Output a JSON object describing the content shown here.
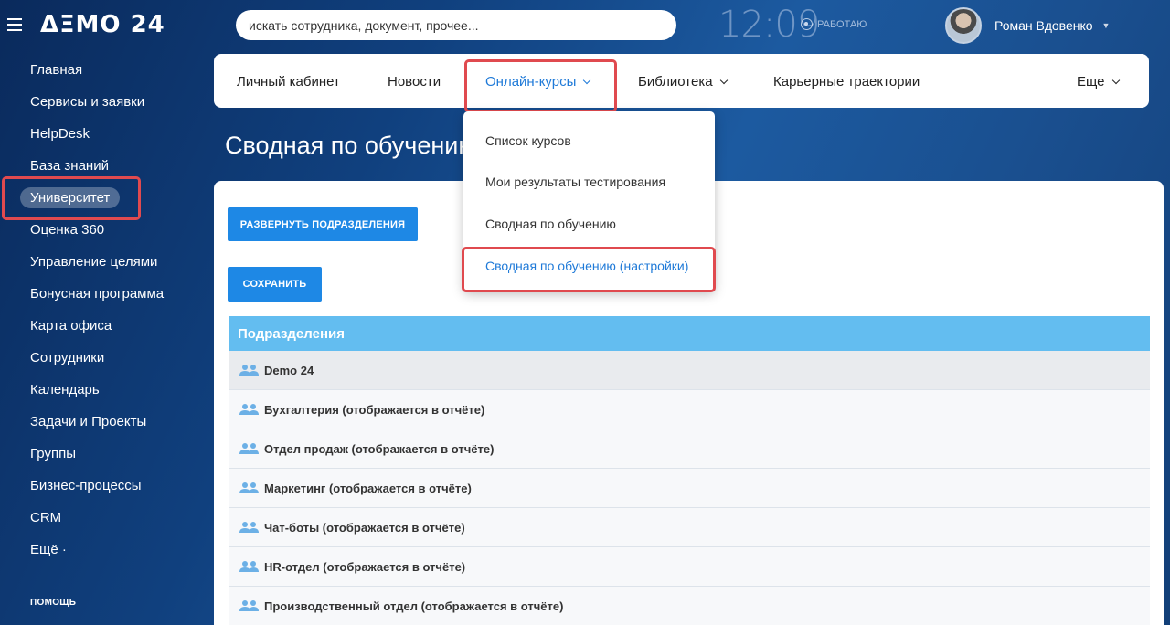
{
  "topbar": {
    "logo": "ΔΞΜΟ 24",
    "search_placeholder": "искать сотрудника, документ, прочее...",
    "clock": "12:09",
    "status": "РАБОТАЮ",
    "user_name": "Роман Вдовенко"
  },
  "sidebar": {
    "items": [
      {
        "label": "Главная"
      },
      {
        "label": "Сервисы и заявки"
      },
      {
        "label": "HelpDesk"
      },
      {
        "label": "База знаний"
      },
      {
        "label": "Университет"
      },
      {
        "label": "Оценка 360"
      },
      {
        "label": "Управление целями"
      },
      {
        "label": "Бонусная программа"
      },
      {
        "label": "Карта офиса"
      },
      {
        "label": "Сотрудники"
      },
      {
        "label": "Календарь"
      },
      {
        "label": "Задачи и Проекты"
      },
      {
        "label": "Группы"
      },
      {
        "label": "Бизнес-процессы"
      },
      {
        "label": "CRM"
      },
      {
        "label": "Ещё ·"
      }
    ],
    "help": "ПОМОЩЬ"
  },
  "nav": {
    "items": [
      {
        "label": "Личный кабинет"
      },
      {
        "label": "Новости"
      },
      {
        "label": "Онлайн-курсы"
      },
      {
        "label": "Библиотека"
      },
      {
        "label": "Карьерные траектории"
      },
      {
        "label": "Еще"
      }
    ]
  },
  "dropdown": {
    "items": [
      {
        "label": "Список курсов"
      },
      {
        "label": "Мои результаты тестирования"
      },
      {
        "label": "Сводная по обучению"
      },
      {
        "label": "Сводная по обучению (настройки)"
      }
    ]
  },
  "page": {
    "title": "Сводная по обучению (",
    "expand_button": "РАЗВЕРНУТЬ ПОДРАЗДЕЛЕНИЯ",
    "save_button": "СОХРАНИТЬ"
  },
  "table": {
    "header": "Подразделения",
    "rows": [
      {
        "label": "Demo 24"
      },
      {
        "label": "Бухгалтерия (отображается в отчёте)"
      },
      {
        "label": "Отдел продаж (отображается в отчёте)"
      },
      {
        "label": "Маркетинг (отображается в отчёте)"
      },
      {
        "label": "Чат-боты (отображается в отчёте)"
      },
      {
        "label": "HR-отдел (отображается в отчёте)"
      },
      {
        "label": "Производственный отдел (отображается в отчёте)"
      }
    ]
  },
  "colors": {
    "accent": "#1e88e5",
    "highlight": "#e04a4f",
    "table_header": "#63bdf0"
  }
}
